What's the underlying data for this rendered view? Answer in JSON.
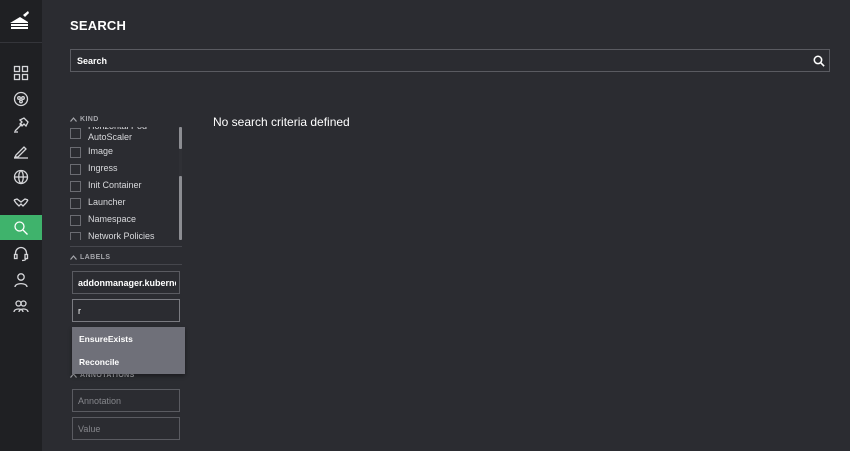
{
  "page": {
    "title": "SEARCH"
  },
  "search": {
    "placeholder": "Search",
    "value": ""
  },
  "sidebar": {
    "items": [
      {
        "name": "dashboard-icon"
      },
      {
        "name": "catalog-icon"
      },
      {
        "name": "hammer-icon"
      },
      {
        "name": "edit-pen-icon"
      },
      {
        "name": "globe-icon"
      },
      {
        "name": "handshake-icon"
      },
      {
        "name": "search-icon",
        "active": true
      },
      {
        "name": "headset-icon"
      },
      {
        "name": "user-icon"
      },
      {
        "name": "users-icon"
      }
    ],
    "active_color": "#3fb36c"
  },
  "filters": {
    "kind": {
      "heading": "KIND",
      "items": [
        {
          "label": "Horizontal Pod AutoScaler",
          "checked": false
        },
        {
          "label": "Image",
          "checked": false
        },
        {
          "label": "Ingress",
          "checked": false
        },
        {
          "label": "Init Container",
          "checked": false
        },
        {
          "label": "Launcher",
          "checked": false
        },
        {
          "label": "Namespace",
          "checked": false
        },
        {
          "label": "Network Policies",
          "checked": false
        }
      ]
    },
    "labels": {
      "heading": "LABELS",
      "key_value": "addonmanager.kubernete",
      "value_input": "r",
      "suggestions": [
        "EnsureExists",
        "Reconcile"
      ]
    },
    "annotations": {
      "heading": "ANNOTATIONS",
      "annotation_placeholder": "Annotation",
      "value_placeholder": "Value"
    }
  },
  "results": {
    "empty_message": "No search criteria defined"
  }
}
